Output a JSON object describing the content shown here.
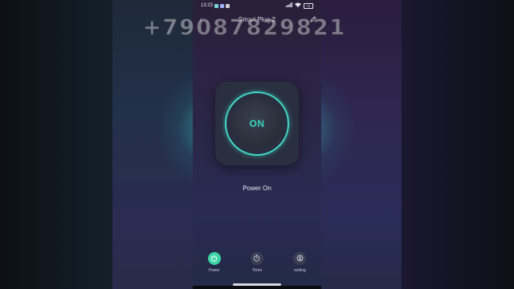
{
  "status_bar": {
    "time": "13:23",
    "battery": "75"
  },
  "header": {
    "title": "Smart Plug 2"
  },
  "watermark": {
    "text": "+79087829821"
  },
  "power_control": {
    "state_label": "ON",
    "accent_color": "#35d6c0"
  },
  "power_status": {
    "text": "Power On"
  },
  "bottom_nav": {
    "items": [
      {
        "label": "Power",
        "icon": "power-icon",
        "active": true
      },
      {
        "label": "Timer",
        "icon": "timer-icon",
        "active": false
      },
      {
        "label": "setting",
        "icon": "setting-icon",
        "active": false
      }
    ]
  }
}
